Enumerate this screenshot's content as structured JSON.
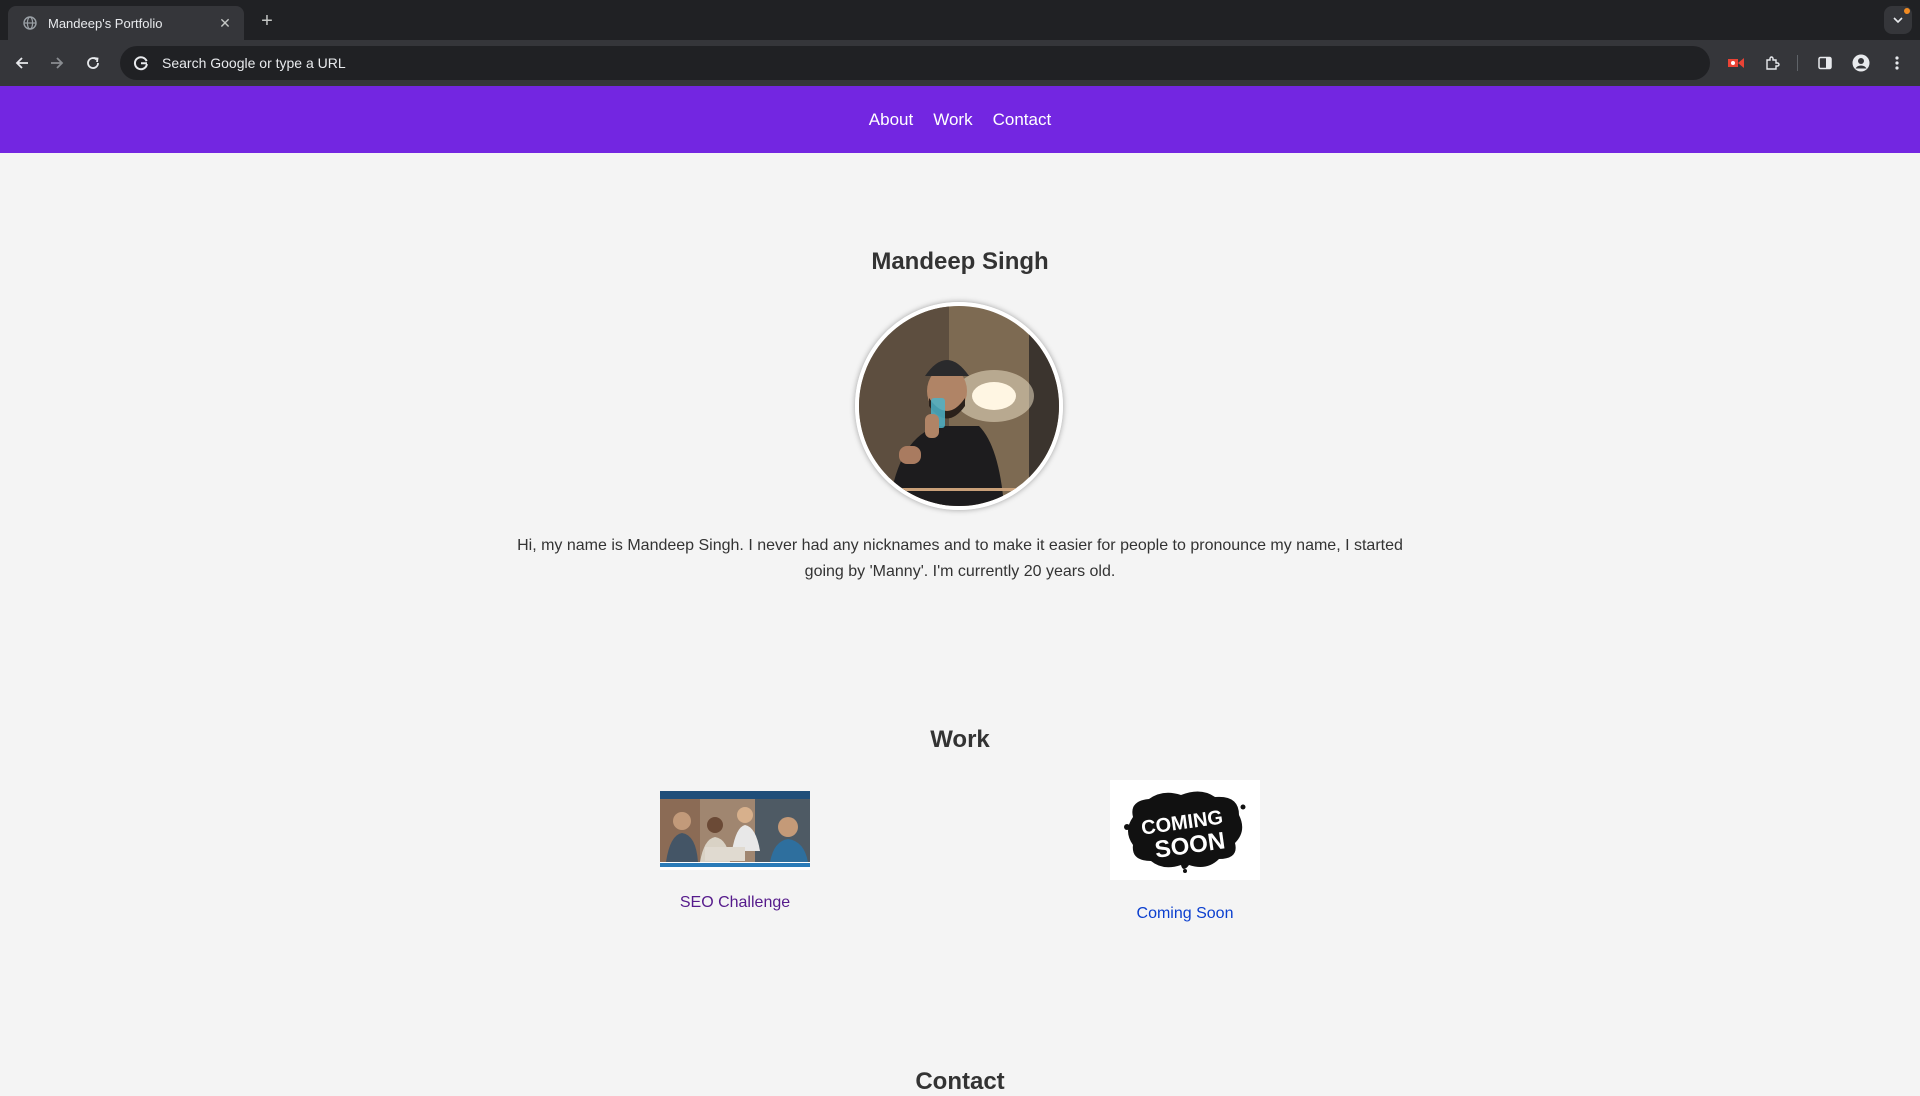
{
  "browser": {
    "tab_title": "Mandeep's Portfolio",
    "omnibox_placeholder": "Search Google or type a URL",
    "accent_dot": "#f28b22"
  },
  "nav": {
    "links": [
      {
        "label": "About"
      },
      {
        "label": "Work"
      },
      {
        "label": "Contact"
      }
    ],
    "color": "#7326e1"
  },
  "about": {
    "name": "Mandeep Singh",
    "bio": "Hi, my name is Mandeep Singh. I never had any nicknames and to make it easier for people to pronounce my name, I started going by 'Manny'. I'm currently 20 years old."
  },
  "work": {
    "title": "Work",
    "items": [
      {
        "label": "SEO Challenge"
      },
      {
        "label": "Coming Soon",
        "image_text_top": "COMING",
        "image_text_bottom": "SOON"
      }
    ]
  },
  "contact": {
    "title": "Contact"
  }
}
